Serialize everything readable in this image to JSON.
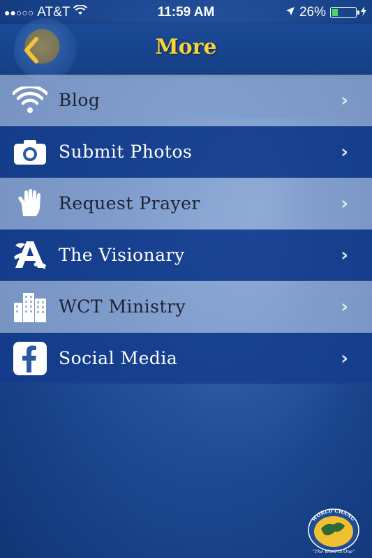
{
  "status_bar": {
    "signal_dots": "●●○○○",
    "carrier": "AT&T",
    "time": "11:59 AM",
    "battery_percent": "26%",
    "battery_level": 0.26
  },
  "nav": {
    "back_icon": "chevron-left-icon",
    "title": "More"
  },
  "menu": {
    "items": [
      {
        "label": "Blog",
        "icon": "wifi-icon"
      },
      {
        "label": "Submit Photos",
        "icon": "camera-icon"
      },
      {
        "label": "Request Prayer",
        "icon": "hand-icon"
      },
      {
        "label": "The Visionary",
        "icon": "letter-a-icon"
      },
      {
        "label": "WCT Ministry",
        "icon": "buildings-icon"
      },
      {
        "label": "Social Media",
        "icon": "facebook-icon"
      }
    ]
  },
  "seal": {
    "org_name": "WORLD CHANGES TABERNACLE",
    "motto": "The Word is One"
  },
  "colors": {
    "accent_yellow": "#f5d33b",
    "nav_blue": "#163f85",
    "row_light": "#b4c8e6",
    "row_dark": "#143c8c"
  }
}
